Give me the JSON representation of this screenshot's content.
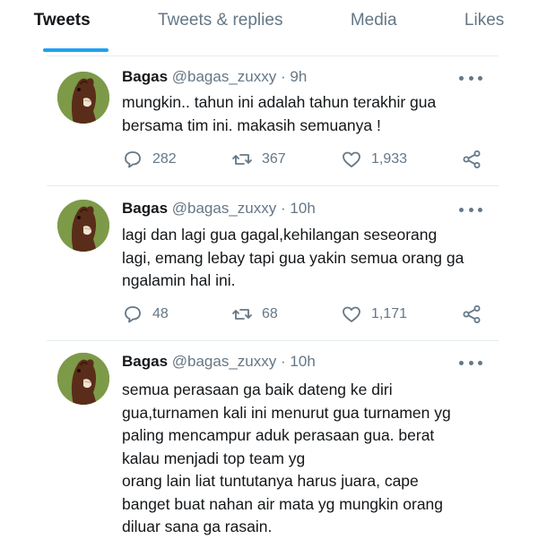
{
  "tabs": [
    {
      "label": "Tweets",
      "active": true
    },
    {
      "label": "Tweets & replies",
      "active": false
    },
    {
      "label": "Media",
      "active": false
    },
    {
      "label": "Likes",
      "active": false
    }
  ],
  "colors": {
    "accent": "#1da1f2",
    "muted": "#657786",
    "text": "#14171a",
    "divider": "#e6ecf0"
  },
  "tweets": [
    {
      "name": "Bagas",
      "handle": "@bagas_zuxxy",
      "time": "9h",
      "lines": [
        "mungkin.. tahun ini adalah tahun terakhir gua",
        "bersama tim ini. makasih semuanya !"
      ],
      "replies": "282",
      "retweets": "367",
      "likes": "1,933"
    },
    {
      "name": "Bagas",
      "handle": "@bagas_zuxxy",
      "time": "10h",
      "lines": [
        "lagi dan lagi gua gagal,kehilangan seseorang",
        "lagi, emang lebay tapi gua yakin semua orang ga",
        "ngalamin hal ini."
      ],
      "replies": "48",
      "retweets": "68",
      "likes": "1,171"
    },
    {
      "name": "Bagas",
      "handle": "@bagas_zuxxy",
      "time": "10h",
      "lines": [
        "semua perasaan ga baik dateng ke diri",
        "gua,turnamen kali ini menurut gua turnamen yg",
        "paling mencampur aduk perasaan gua. berat",
        "kalau menjadi top team yg",
        "orang lain liat tuntutanya harus juara, cape",
        "banget buat nahan air mata yg mungkin orang",
        "diluar sana ga rasain."
      ]
    }
  ]
}
